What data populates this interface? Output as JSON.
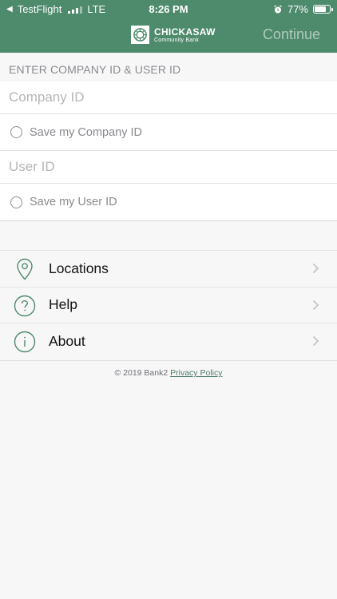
{
  "status_bar": {
    "back_app": "TestFlight",
    "network": "LTE",
    "time": "8:26 PM",
    "battery": "77%",
    "battery_level": 0.77
  },
  "header": {
    "logo_name": "CHICKASAW",
    "logo_sub": "Community Bank",
    "continue_label": "Continue",
    "color": "#4e8a6c"
  },
  "form": {
    "section_title": "ENTER COMPANY ID & USER ID",
    "company_id_placeholder": "Company ID",
    "save_company_label": "Save my Company ID",
    "user_id_placeholder": "User ID",
    "save_user_label": "Save my User ID"
  },
  "menu": {
    "items": [
      {
        "label": "Locations",
        "icon": "location-pin-icon"
      },
      {
        "label": "Help",
        "icon": "question-circle-icon"
      },
      {
        "label": "About",
        "icon": "info-circle-icon"
      }
    ]
  },
  "footer": {
    "copyright": "© 2019 Bank2",
    "privacy_link": "Privacy Policy"
  }
}
